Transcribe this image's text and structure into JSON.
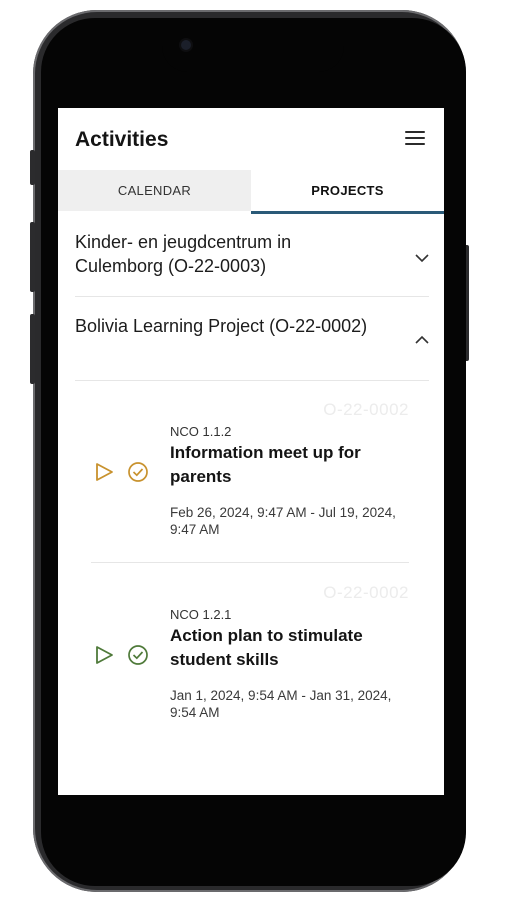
{
  "header": {
    "title": "Activities"
  },
  "tabs": [
    {
      "label": "CALENDAR",
      "active": false
    },
    {
      "label": "PROJECTS",
      "active": true
    }
  ],
  "projects": [
    {
      "name": "Kinder- en jeugdcentrum in Culemborg  (O-22-0003)",
      "expanded": false
    },
    {
      "name": "Bolivia Learning Project (O-22-0002)",
      "expanded": true
    }
  ],
  "activities": [
    {
      "code": "O-22-0002",
      "nco": "NCO 1.1.2",
      "title": "Information meet up for parents",
      "dates": "Feb 26, 2024, 9:47 AM - Jul 19, 2024, 9:47 AM",
      "icon_color": "#c8922e",
      "icons": [
        "play-icon",
        "check-circle-icon"
      ]
    },
    {
      "code": "O-22-0002",
      "nco": "NCO 1.2.1",
      "title": "Action plan to stimulate student skills",
      "dates": "Jan 1, 2024, 9:54 AM - Jan 31, 2024, 9:54 AM",
      "icon_color": "#4f7a3a",
      "icons": [
        "play-icon",
        "check-circle-icon"
      ]
    }
  ],
  "colors": {
    "tab_underline": "#2a5a78",
    "tab_inactive_bg": "#efefef"
  }
}
